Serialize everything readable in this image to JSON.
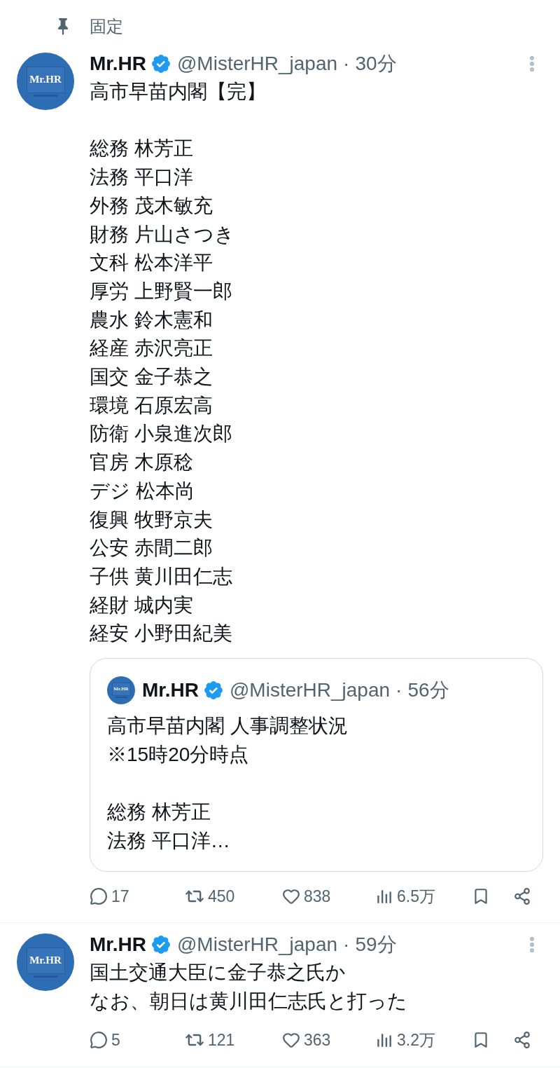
{
  "tweets": [
    {
      "pinned": {
        "label": "固定"
      },
      "author": {
        "name": "Mr.HR",
        "verified": true,
        "handle": "@MisterHR_japan",
        "avatar_text": "Mr.HR"
      },
      "separator": "·",
      "time": "30分",
      "paragraphs": [
        [
          "高市早苗内閣【完】"
        ],
        [
          "総務 林芳正",
          "法務 平口洋",
          "外務 茂木敏充",
          "財務 片山さつき",
          "文科 松本洋平",
          "厚労 上野賢一郎",
          "農水 鈴木憲和",
          "経産 赤沢亮正",
          "国交 金子恭之",
          "環境 石原宏高",
          "防衛 小泉進次郎",
          "官房 木原稔",
          "デジ 松本尚",
          "復興 牧野京夫",
          "公安 赤間二郎",
          "子供 黄川田仁志",
          "経財 城内実",
          "経安 小野田紀美"
        ]
      ],
      "quote": {
        "author": {
          "name": "Mr.HR",
          "verified": true,
          "handle": "@MisterHR_japan",
          "avatar_text": "Mr.HR"
        },
        "separator": "·",
        "time": "56分",
        "paragraphs": [
          [
            "高市早苗内閣 人事調整状況",
            "※15時20分時点"
          ],
          [
            "総務 林芳正",
            "法務 平口洋…"
          ]
        ]
      },
      "actions": [
        {
          "kind": "reply",
          "count": "17"
        },
        {
          "kind": "repost",
          "count": "450"
        },
        {
          "kind": "like",
          "count": "838"
        },
        {
          "kind": "views",
          "count": "6.5万"
        },
        {
          "kind": "bookmark"
        },
        {
          "kind": "share"
        }
      ]
    },
    {
      "author": {
        "name": "Mr.HR",
        "verified": true,
        "handle": "@MisterHR_japan",
        "avatar_text": "Mr.HR"
      },
      "separator": "·",
      "time": "59分",
      "paragraphs": [
        [
          "国土交通大臣に金子恭之氏か",
          "なお、朝日は黄川田仁志氏と打った"
        ]
      ],
      "actions": [
        {
          "kind": "reply",
          "count": "5"
        },
        {
          "kind": "repost",
          "count": "121"
        },
        {
          "kind": "like",
          "count": "363"
        },
        {
          "kind": "views",
          "count": "3.2万"
        },
        {
          "kind": "bookmark"
        },
        {
          "kind": "share"
        }
      ]
    }
  ]
}
